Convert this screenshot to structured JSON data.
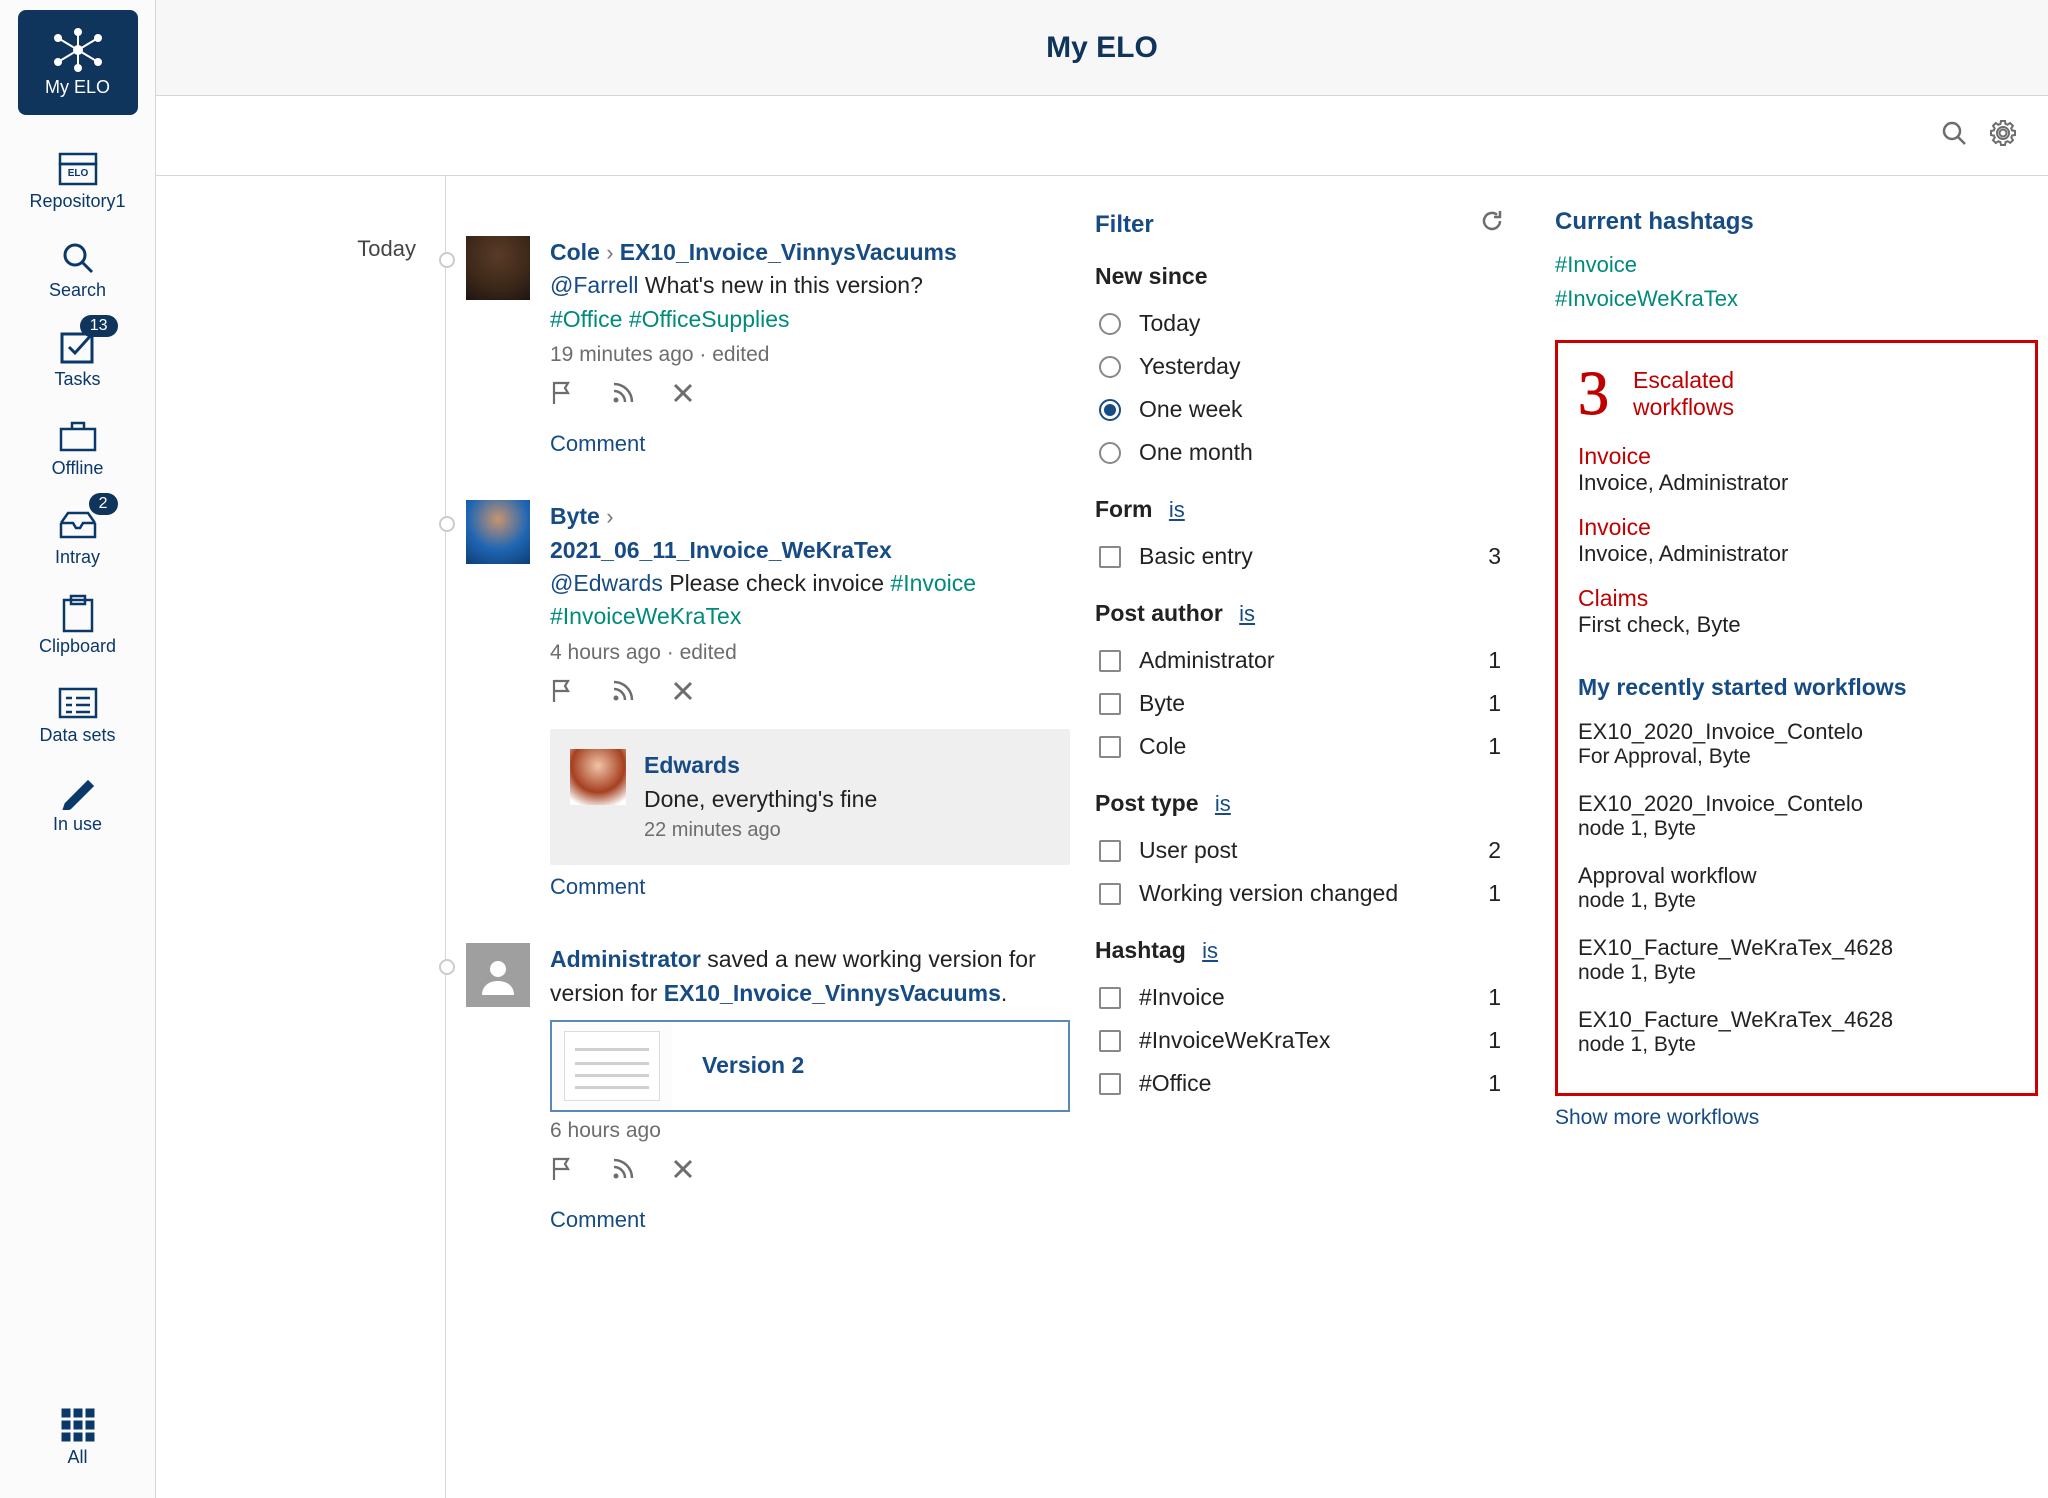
{
  "app": {
    "title": "My ELO"
  },
  "sidebar": {
    "myelo_label": "My ELO",
    "items": [
      {
        "label": "Repository1"
      },
      {
        "label": "Search"
      },
      {
        "label": "Tasks",
        "badge": "13"
      },
      {
        "label": "Offline"
      },
      {
        "label": "Intray",
        "badge": "2"
      },
      {
        "label": "Clipboard"
      },
      {
        "label": "Data sets"
      },
      {
        "label": "In use"
      }
    ],
    "all_label": "All"
  },
  "timeline": {
    "today": "Today"
  },
  "feed": {
    "posts": [
      {
        "author": "Cole",
        "subject": "EX10_Invoice_VinnysVacuums",
        "mention": "@Farrell",
        "body": "What's new in this version?",
        "tags": "#Office #OfficeSupplies",
        "meta": "19 minutes ago  ·  edited",
        "comment_label": "Comment"
      },
      {
        "author": "Byte",
        "subject": "2021_06_11_Invoice_WeKraTex",
        "mention": "@Edwards",
        "body": "Please check invoice",
        "inline_tag": "#Invoice",
        "second_line_tag": "#InvoiceWeKraTex",
        "meta": "4 hours ago  ·  edited",
        "reply": {
          "name": "Edwards",
          "text": "Done, everything's fine",
          "time": "22 minutes ago"
        },
        "comment_label": "Comment"
      },
      {
        "author": "Administrator",
        "body_prefix": "saved a new working version for",
        "subject": "EX10_Invoice_VinnysVacuums",
        "body_suffix": ".",
        "version_label": "Version 2",
        "meta": "6 hours ago",
        "comment_label": "Comment"
      }
    ]
  },
  "filter": {
    "heading": "Filter",
    "new_since": {
      "title": "New since",
      "options": [
        "Today",
        "Yesterday",
        "One week",
        "One month"
      ],
      "selected": "One week"
    },
    "is_label": "is",
    "form": {
      "title": "Form",
      "items": [
        {
          "label": "Basic entry",
          "count": "3"
        }
      ]
    },
    "author": {
      "title": "Post author",
      "items": [
        {
          "label": "Administrator",
          "count": "1"
        },
        {
          "label": "Byte",
          "count": "1"
        },
        {
          "label": "Cole",
          "count": "1"
        }
      ]
    },
    "ptype": {
      "title": "Post type",
      "items": [
        {
          "label": "User post",
          "count": "2"
        },
        {
          "label": "Working version changed",
          "count": "1"
        }
      ]
    },
    "hashtag": {
      "title": "Hashtag",
      "items": [
        {
          "label": "#Invoice",
          "count": "1"
        },
        {
          "label": "#InvoiceWeKraTex",
          "count": "1"
        },
        {
          "label": "#Office",
          "count": "1"
        }
      ]
    }
  },
  "right": {
    "current_hashtags_heading": "Current hashtags",
    "tags": [
      "#Invoice",
      "#InvoiceWeKraTex"
    ],
    "escalated": {
      "count": "3",
      "label1": "Escalated",
      "label2": "workflows",
      "items": [
        {
          "t1": "Invoice",
          "t2": "Invoice, Administrator"
        },
        {
          "t1": "Invoice",
          "t2": "Invoice, Administrator"
        },
        {
          "t1": "Claims",
          "t2": "First check, Byte"
        }
      ]
    },
    "workflows": {
      "heading": "My recently started workflows",
      "items": [
        {
          "t1": "EX10_2020_Invoice_Contelo",
          "t2": "For Approval, Byte"
        },
        {
          "t1": "EX10_2020_Invoice_Contelo",
          "t2": "node 1, Byte"
        },
        {
          "t1": "Approval workflow",
          "t2": "node 1, Byte"
        },
        {
          "t1": "EX10_Facture_WeKraTex_4628",
          "t2": "node 1, Byte"
        },
        {
          "t1": "EX10_Facture_WeKraTex_4628",
          "t2": "node 1, Byte"
        }
      ],
      "show_more": "Show more workflows"
    }
  }
}
